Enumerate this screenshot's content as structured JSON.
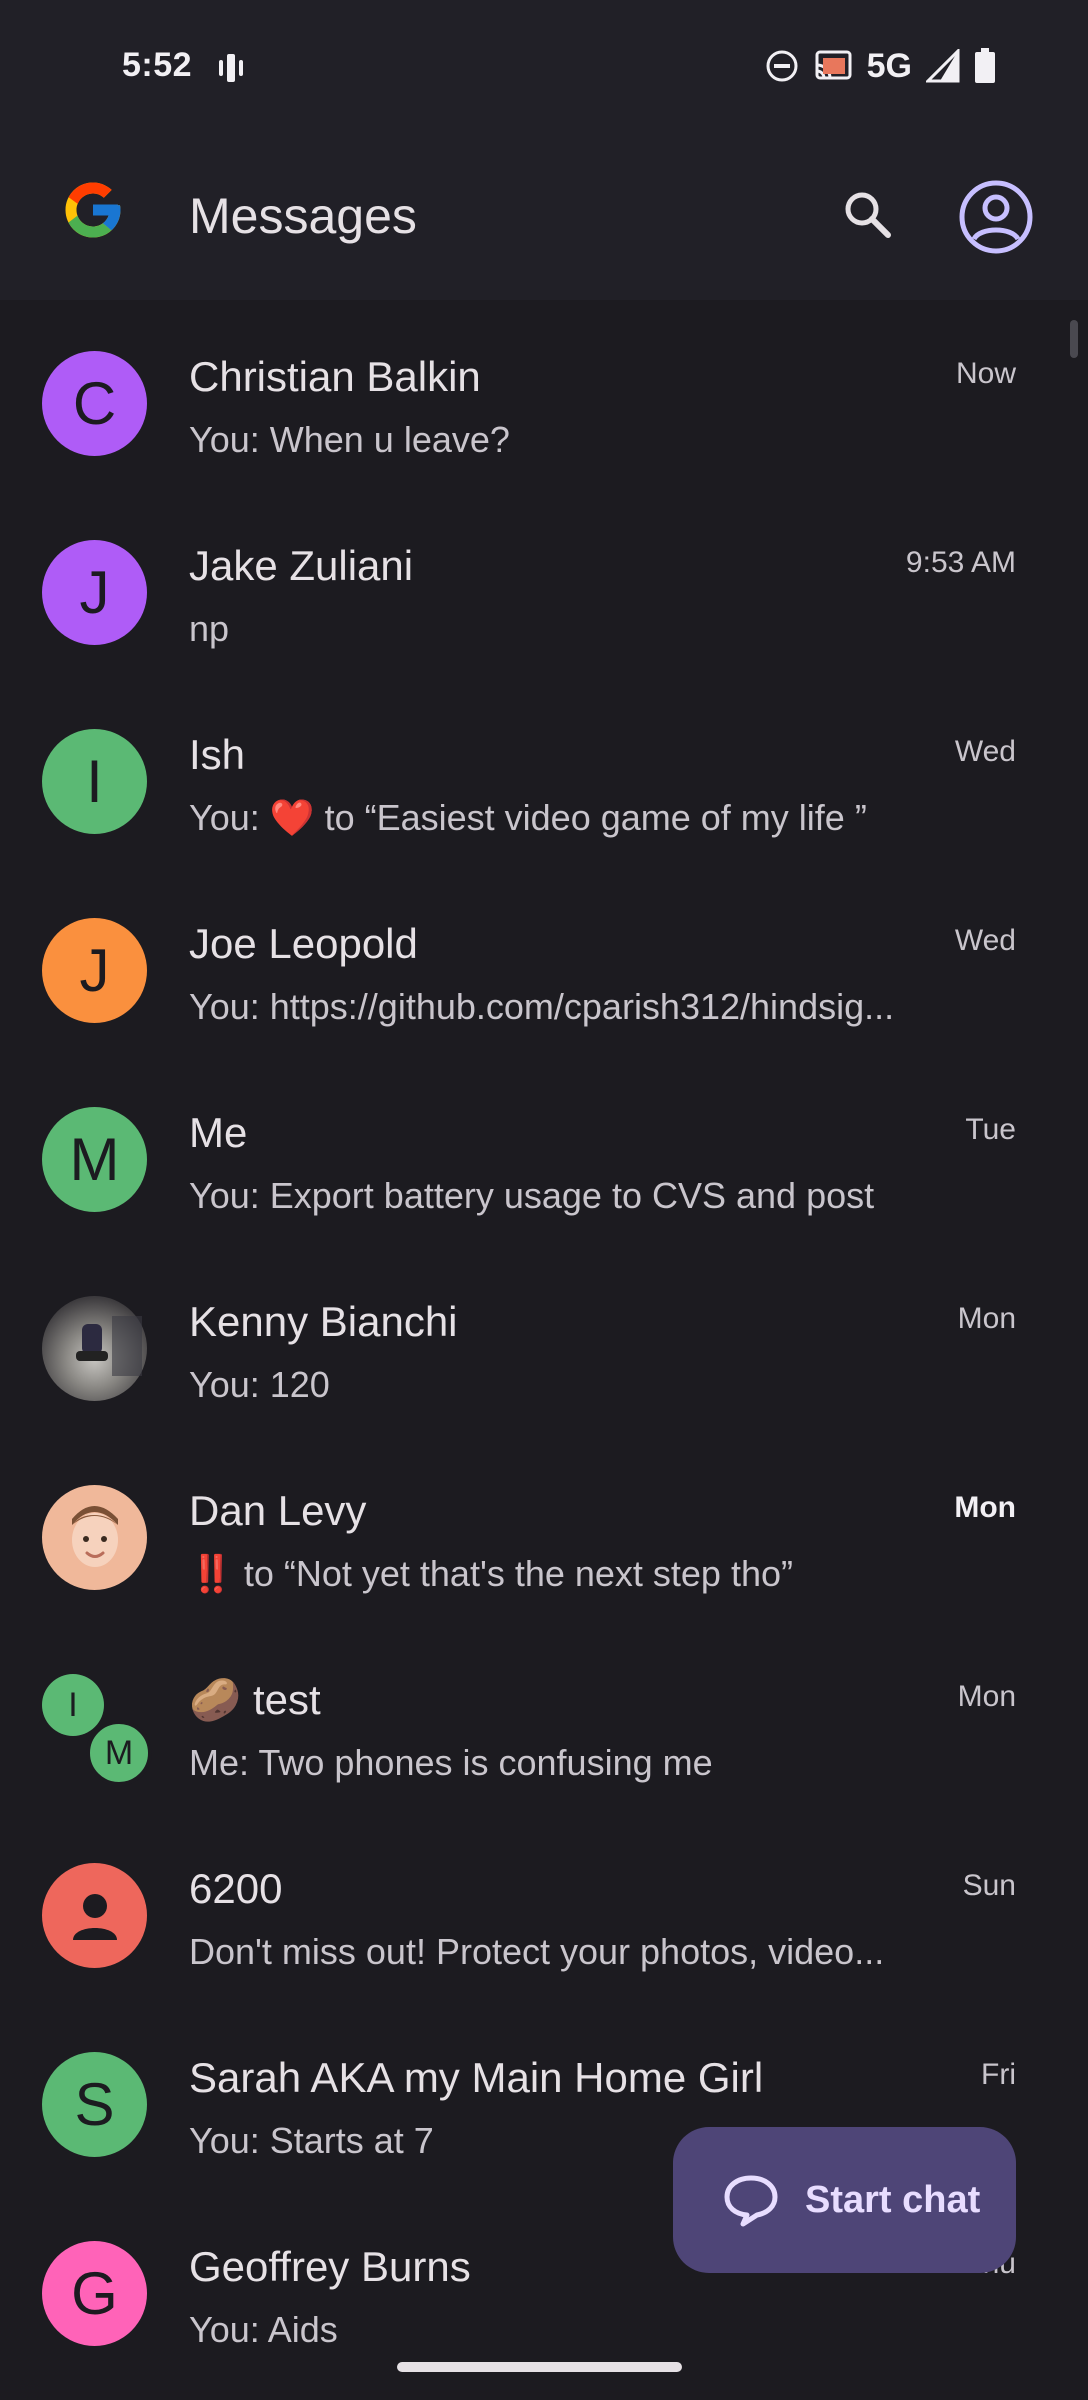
{
  "status": {
    "time": "5:52",
    "network": "5G",
    "icons": [
      "vibrate-icon",
      "dnd-icon",
      "cast-icon",
      "signal-icon",
      "battery-icon"
    ]
  },
  "appbar": {
    "title": "Messages",
    "logo": "google-logo",
    "search_icon": "search-icon",
    "account_icon": "account-circle-icon"
  },
  "conversations": [
    {
      "initial": "C",
      "name": "Christian Balkin",
      "preview": "You: When u leave?",
      "time": "Now",
      "avatar_color": "#af5cf7",
      "unread": false
    },
    {
      "initial": "J",
      "name": "Jake Zuliani",
      "preview": "np",
      "time": "9:53 AM",
      "avatar_color": "#af5cf7",
      "unread": false
    },
    {
      "initial": "I",
      "name": "Ish",
      "preview_prefix": "You: ",
      "preview_emoji": "❤️",
      "preview_suffix": " to “Easiest video game of my life ”",
      "time": "Wed",
      "avatar_color": "#5bb974",
      "unread": false
    },
    {
      "initial": "J",
      "name": "Joe Leopold",
      "preview": "You: https://github.com/cparish312/hindsig...",
      "time": "Wed",
      "avatar_color": "#fa903e",
      "unread": false
    },
    {
      "initial": "M",
      "name": "Me",
      "preview": "You: Export battery usage to CVS and post",
      "time": "Tue",
      "avatar_color": "#5bb974",
      "unread": false
    },
    {
      "initial": "",
      "name": "Kenny Bianchi",
      "preview": "You: 120",
      "time": "Mon",
      "avatar_color": "#5c5a63",
      "unread": false
    },
    {
      "initial": "",
      "name": "Dan Levy",
      "preview_emoji": "‼️",
      "preview_suffix": " to “Not yet that's the next step tho”",
      "time": "Mon",
      "avatar_color": "#f0b89a",
      "unread": true
    },
    {
      "initial_a": "I",
      "initial_b": "M",
      "name_emoji": "🥔",
      "name": "test",
      "preview": "Me: Two phones is confusing me",
      "time": "Mon",
      "avatar_color": "#5bb974",
      "unread": false
    },
    {
      "initial": "",
      "name": "6200",
      "preview": "Don't miss out! Protect your photos, video...",
      "time": "Sun",
      "avatar_color": "#ee675c",
      "unread": false
    },
    {
      "initial": "S",
      "name": "Sarah AKA my Main Home Girl",
      "preview": "You: Starts at 7",
      "time": "Fri",
      "avatar_color": "#5bb974",
      "unread": false
    },
    {
      "initial": "G",
      "name": "Geoffrey Burns",
      "preview": "You: Aids",
      "time": "Thu",
      "avatar_color": "#ff63b8",
      "unread": false
    }
  ],
  "fab": {
    "label": "Start chat",
    "icon": "chat-bubble-icon"
  }
}
